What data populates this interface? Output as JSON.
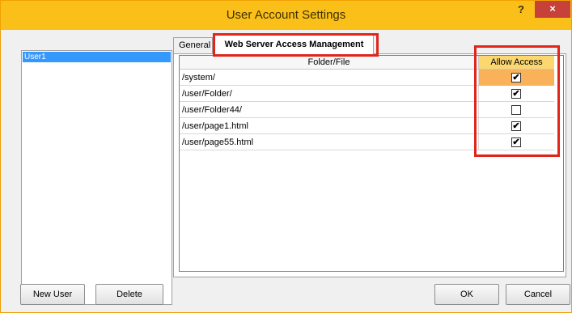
{
  "window": {
    "title": "User Account Settings",
    "help_label": "?",
    "close_label": "×"
  },
  "users": [
    {
      "label": "User1",
      "selected": true
    }
  ],
  "tabs": [
    {
      "label": "General",
      "active": false
    },
    {
      "label": "Web Server Access Management",
      "active": true
    }
  ],
  "grid": {
    "columns": {
      "folder": "Folder/File",
      "allow": "Allow Access"
    },
    "rows": [
      {
        "path": "/system/",
        "allow": true,
        "selected": true
      },
      {
        "path": "/user/Folder/",
        "allow": true,
        "selected": false
      },
      {
        "path": "/user/Folder44/",
        "allow": false,
        "selected": false
      },
      {
        "path": "/user/page1.html",
        "allow": true,
        "selected": false
      },
      {
        "path": "/user/page55.html",
        "allow": true,
        "selected": false
      }
    ]
  },
  "buttons": {
    "new_user": "New User",
    "delete": "Delete",
    "ok": "OK",
    "cancel": "Cancel"
  },
  "colors": {
    "title_bar": "#fbbf1a",
    "close_button": "#c7413a",
    "selection_blue": "#3399ff",
    "highlight_red": "#e1251b",
    "allow_header": "#fcd66e",
    "selected_allow_cell": "#f9b15a"
  },
  "icons": {
    "close": "close-icon",
    "help": "help-icon",
    "checkbox": "checkbox-icon"
  }
}
